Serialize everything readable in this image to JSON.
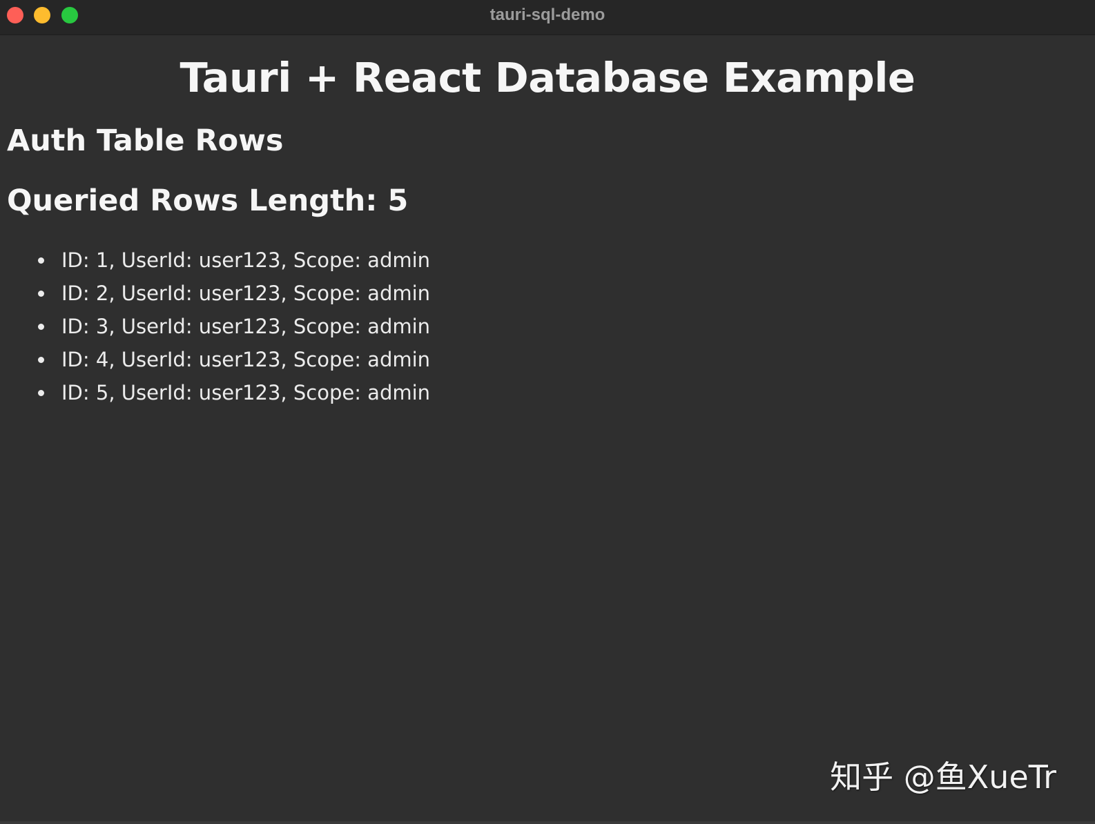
{
  "window": {
    "title": "tauri-sql-demo"
  },
  "app": {
    "title": "Tauri + React Database Example",
    "section_heading": "Auth Table Rows",
    "rows_length_text": "Queried Rows Length: 5",
    "rows": [
      {
        "text": "ID: 1, UserId: user123, Scope: admin"
      },
      {
        "text": "ID: 2, UserId: user123, Scope: admin"
      },
      {
        "text": "ID: 3, UserId: user123, Scope: admin"
      },
      {
        "text": "ID: 4, UserId: user123, Scope: admin"
      },
      {
        "text": "ID: 5, UserId: user123, Scope: admin"
      }
    ]
  },
  "watermark": {
    "text": "知乎 @鱼XueTr"
  },
  "colors": {
    "close": "#fe5f57",
    "minimize": "#febc2e",
    "maximize": "#28c840",
    "background": "#2f2f2f",
    "titlebar": "#262626"
  }
}
